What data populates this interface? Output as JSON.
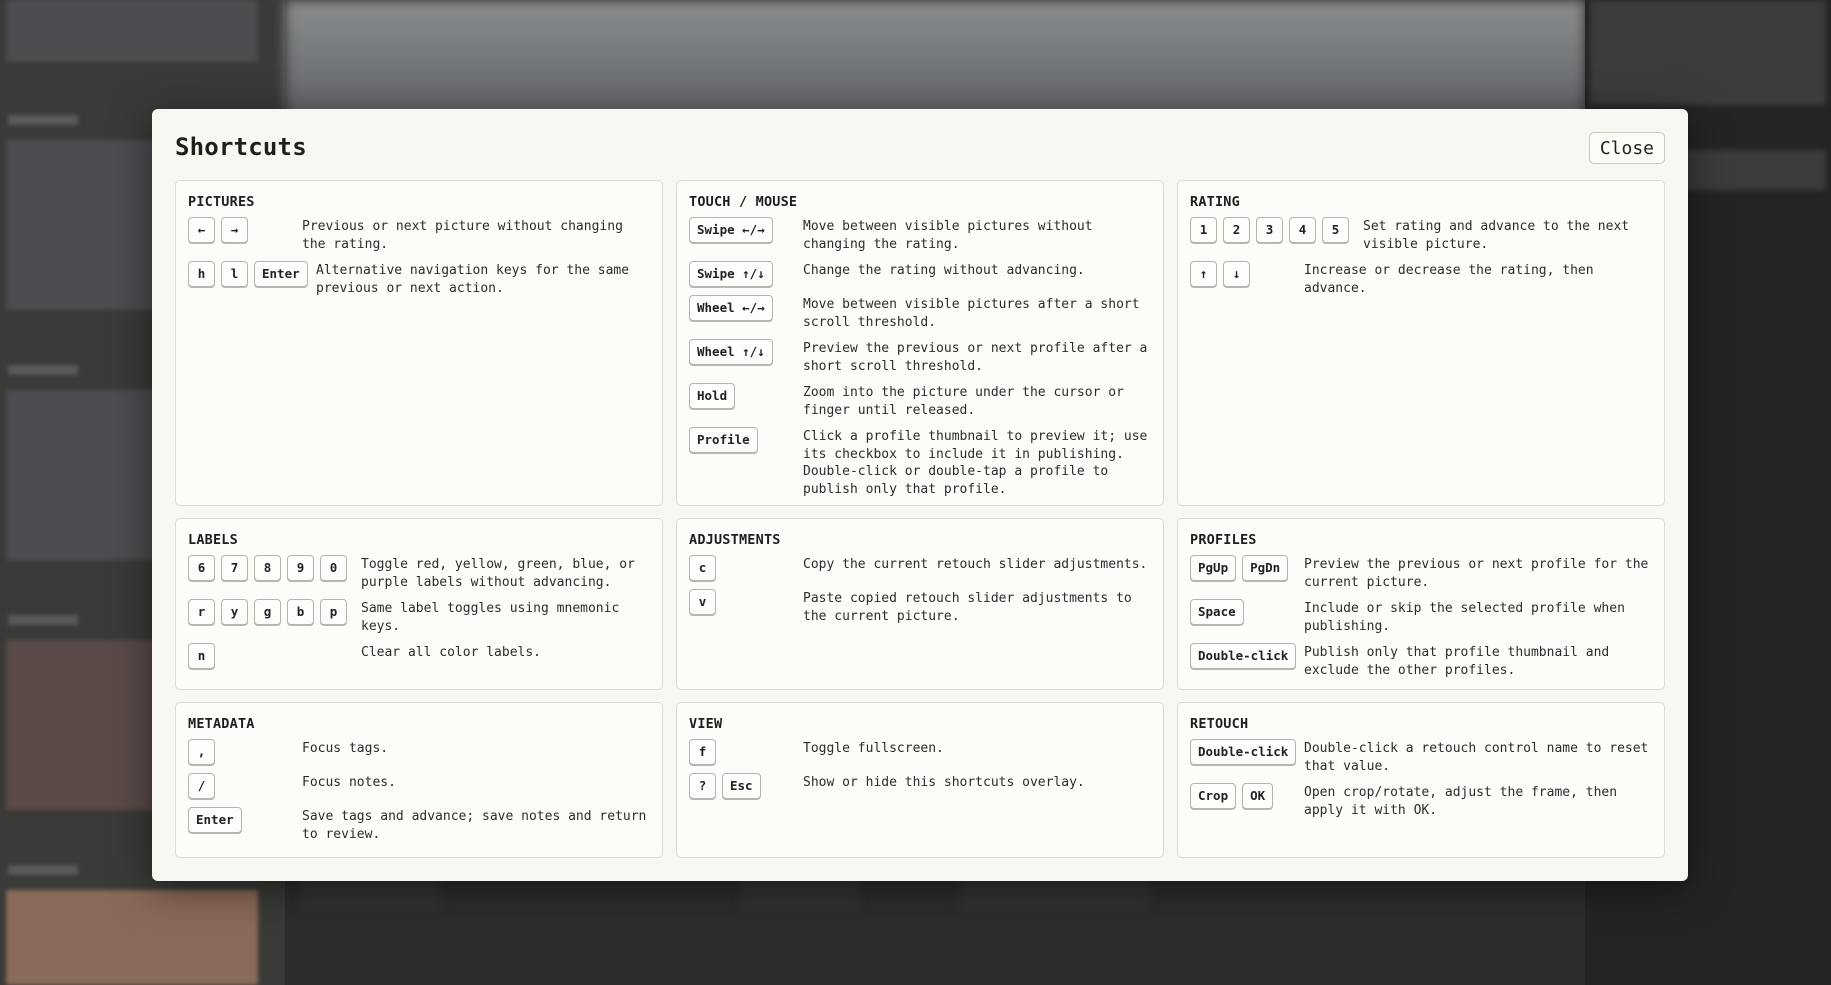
{
  "modal": {
    "title": "Shortcuts",
    "close_label": "Close"
  },
  "sections": {
    "pictures": {
      "title": "PICTURES",
      "rows": [
        {
          "keys": [
            "←",
            "→"
          ],
          "desc": "Previous or next picture without changing the rating."
        },
        {
          "keys": [
            "h",
            "l",
            "Enter"
          ],
          "desc": "Alternative navigation keys for the same previous or next action."
        }
      ]
    },
    "touch_mouse": {
      "title": "TOUCH / MOUSE",
      "rows": [
        {
          "keys": [
            "Swipe ←/→"
          ],
          "desc": "Move between visible pictures without changing the rating."
        },
        {
          "keys": [
            "Swipe ↑/↓"
          ],
          "desc": "Change the rating without advancing."
        },
        {
          "keys": [
            "Wheel ←/→"
          ],
          "desc": "Move between visible pictures after a short scroll threshold."
        },
        {
          "keys": [
            "Wheel ↑/↓"
          ],
          "desc": "Preview the previous or next profile after a short scroll threshold."
        },
        {
          "keys": [
            "Hold"
          ],
          "desc": "Zoom into the picture under the cursor or finger until released."
        },
        {
          "keys": [
            "Profile"
          ],
          "desc": "Click a profile thumbnail to preview it; use its checkbox to include it in publishing. Double-click or double-tap a profile to publish only that profile."
        }
      ]
    },
    "rating": {
      "title": "RATING",
      "rows": [
        {
          "keys": [
            "1",
            "2",
            "3",
            "4",
            "5"
          ],
          "desc": "Set rating and advance to the next visible picture."
        },
        {
          "keys": [
            "↑",
            "↓"
          ],
          "desc": "Increase or decrease the rating, then advance."
        }
      ]
    },
    "labels": {
      "title": "LABELS",
      "rows": [
        {
          "keys": [
            "6",
            "7",
            "8",
            "9",
            "0"
          ],
          "desc": "Toggle red, yellow, green, blue, or purple labels without advancing."
        },
        {
          "keys": [
            "r",
            "y",
            "g",
            "b",
            "p"
          ],
          "desc": "Same label toggles using mnemonic keys."
        },
        {
          "keys": [
            "n"
          ],
          "desc": "Clear all color labels."
        }
      ]
    },
    "adjustments": {
      "title": "ADJUSTMENTS",
      "rows": [
        {
          "keys": [
            "c"
          ],
          "desc": "Copy the current retouch slider adjustments."
        },
        {
          "keys": [
            "v"
          ],
          "desc": "Paste copied retouch slider adjustments to the current picture."
        }
      ]
    },
    "profiles": {
      "title": "PROFILES",
      "rows": [
        {
          "keys": [
            "PgUp",
            "PgDn"
          ],
          "desc": "Preview the previous or next profile for the current picture."
        },
        {
          "keys": [
            "Space"
          ],
          "desc": "Include or skip the selected profile when publishing."
        },
        {
          "keys": [
            "Double-click"
          ],
          "desc": "Publish only that profile thumbnail and exclude the other profiles."
        }
      ]
    },
    "metadata": {
      "title": "METADATA",
      "rows": [
        {
          "keys": [
            ","
          ],
          "desc": "Focus tags."
        },
        {
          "keys": [
            "/"
          ],
          "desc": "Focus notes."
        },
        {
          "keys": [
            "Enter"
          ],
          "desc": "Save tags and advance; save notes and return to review."
        }
      ]
    },
    "view": {
      "title": "VIEW",
      "rows": [
        {
          "keys": [
            "f"
          ],
          "desc": "Toggle fullscreen."
        },
        {
          "keys": [
            "?",
            "Esc"
          ],
          "desc": "Show or hide this shortcuts overlay."
        }
      ]
    },
    "retouch": {
      "title": "RETOUCH",
      "rows": [
        {
          "keys": [
            "Double-click"
          ],
          "desc": "Double-click a retouch control name to reset that value."
        },
        {
          "keys": [
            "Crop",
            "OK"
          ],
          "desc": "Open crop/rotate, adjust the frame, then apply it with OK."
        }
      ]
    }
  }
}
